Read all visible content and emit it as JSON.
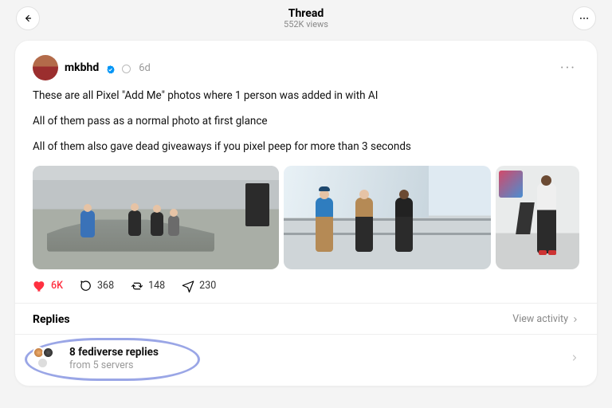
{
  "header": {
    "title": "Thread",
    "subtitle": "552K views"
  },
  "post": {
    "username": "mkbhd",
    "timestamp": "6d",
    "paragraphs": [
      "These are all Pixel \"Add Me\" photos where 1 person was added in with AI",
      "All of them pass as a normal photo at first glance",
      "All of them also gave dead giveaways if you pixel peep for more than 3 seconds"
    ],
    "actions": {
      "likes": "6K",
      "comments": "368",
      "reposts": "148",
      "shares": "230"
    }
  },
  "replies": {
    "label": "Replies",
    "view_activity": "View activity"
  },
  "fediverse": {
    "title": "8 fediverse replies",
    "subtitle": "from 5 servers"
  }
}
